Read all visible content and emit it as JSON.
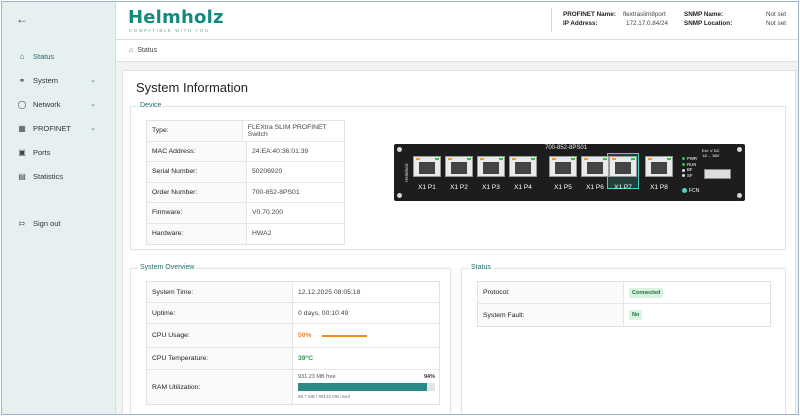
{
  "sidebar": {
    "back_icon": "arrow-left-icon",
    "items": [
      {
        "label": "Status",
        "icon": "home-icon",
        "active": true
      },
      {
        "label": "System",
        "icon": "link-icon",
        "chevron": true
      },
      {
        "label": "Network",
        "icon": "globe-icon",
        "chevron": true
      },
      {
        "label": "PROFINET",
        "icon": "grid-icon",
        "chevron": true
      },
      {
        "label": "Ports",
        "icon": "port-icon"
      },
      {
        "label": "Statistics",
        "icon": "chart-icon"
      },
      {
        "label": "Sign out",
        "icon": "signout-icon"
      }
    ]
  },
  "header": {
    "logo_text": "Helmholz",
    "logo_tagline": "COMPATIBLE WITH YOU",
    "profinet_name_label": "PROFINET Name:",
    "profinet_name_value": "flextraslim8port",
    "ip_label": "IP Address:",
    "ip_value": "172.17.0.84/24",
    "snmp_name_label": "SNMP Name:",
    "snmp_name_value": "Not set",
    "snmp_location_label": "SNMP Location:",
    "snmp_location_value": "Not set"
  },
  "breadcrumb": {
    "icon": "home-icon",
    "label": "Status"
  },
  "page_title": "System Information",
  "device": {
    "section_title": "Device",
    "rows": [
      {
        "label": "Type:",
        "value": "FLEXtra SLIM PROFINET Switch"
      },
      {
        "label": "MAC Address:",
        "value": "24:EA:40:36:01:39"
      },
      {
        "label": "Serial Number:",
        "value": "50206920"
      },
      {
        "label": "Order Number:",
        "value": "700-852-8PS01"
      },
      {
        "label": "Firmware:",
        "value": "V0.70.200"
      },
      {
        "label": "Hardware:",
        "value": "HWA2"
      }
    ],
    "image": {
      "model": "700-852-8PS01",
      "brand": "Helmholz",
      "ports": [
        "X1 P1",
        "X1 P2",
        "X1 P3",
        "X1 P4",
        "X1 P5",
        "X1 P6",
        "X1 P7",
        "X1 P8"
      ],
      "leds": [
        "PWR",
        "RUN",
        "BF",
        "SF",
        "FCN"
      ],
      "power_label": "Ext. V DC",
      "power_range": "18 ... 36V"
    }
  },
  "overview": {
    "section_title": "System Overview",
    "system_time_label": "System Time:",
    "system_time_value": "12.12.2025 08:05:18",
    "uptime_label": "Uptime:",
    "uptime_value": "0 days, 00:10:49",
    "cpu_usage_label": "CPU Usage:",
    "cpu_usage_value": "50%",
    "cpu_temp_label": "CPU Temperature:",
    "cpu_temp_value": "39°C",
    "ram_label": "RAM Utilization:",
    "ram_free": "931.23 MB free",
    "ram_percent": "94%",
    "ram_fraction": 0.94,
    "ram_used": "68.7 MB / 99133 MB used",
    "colors": {
      "cpu": "#f08a24",
      "temp": "#2e9a48",
      "ram": "#2b8a87"
    }
  },
  "status": {
    "section_title": "Status",
    "protocol_label": "Protocol:",
    "protocol_value": "Connected",
    "fault_label": "System Fault:",
    "fault_value": "No"
  }
}
